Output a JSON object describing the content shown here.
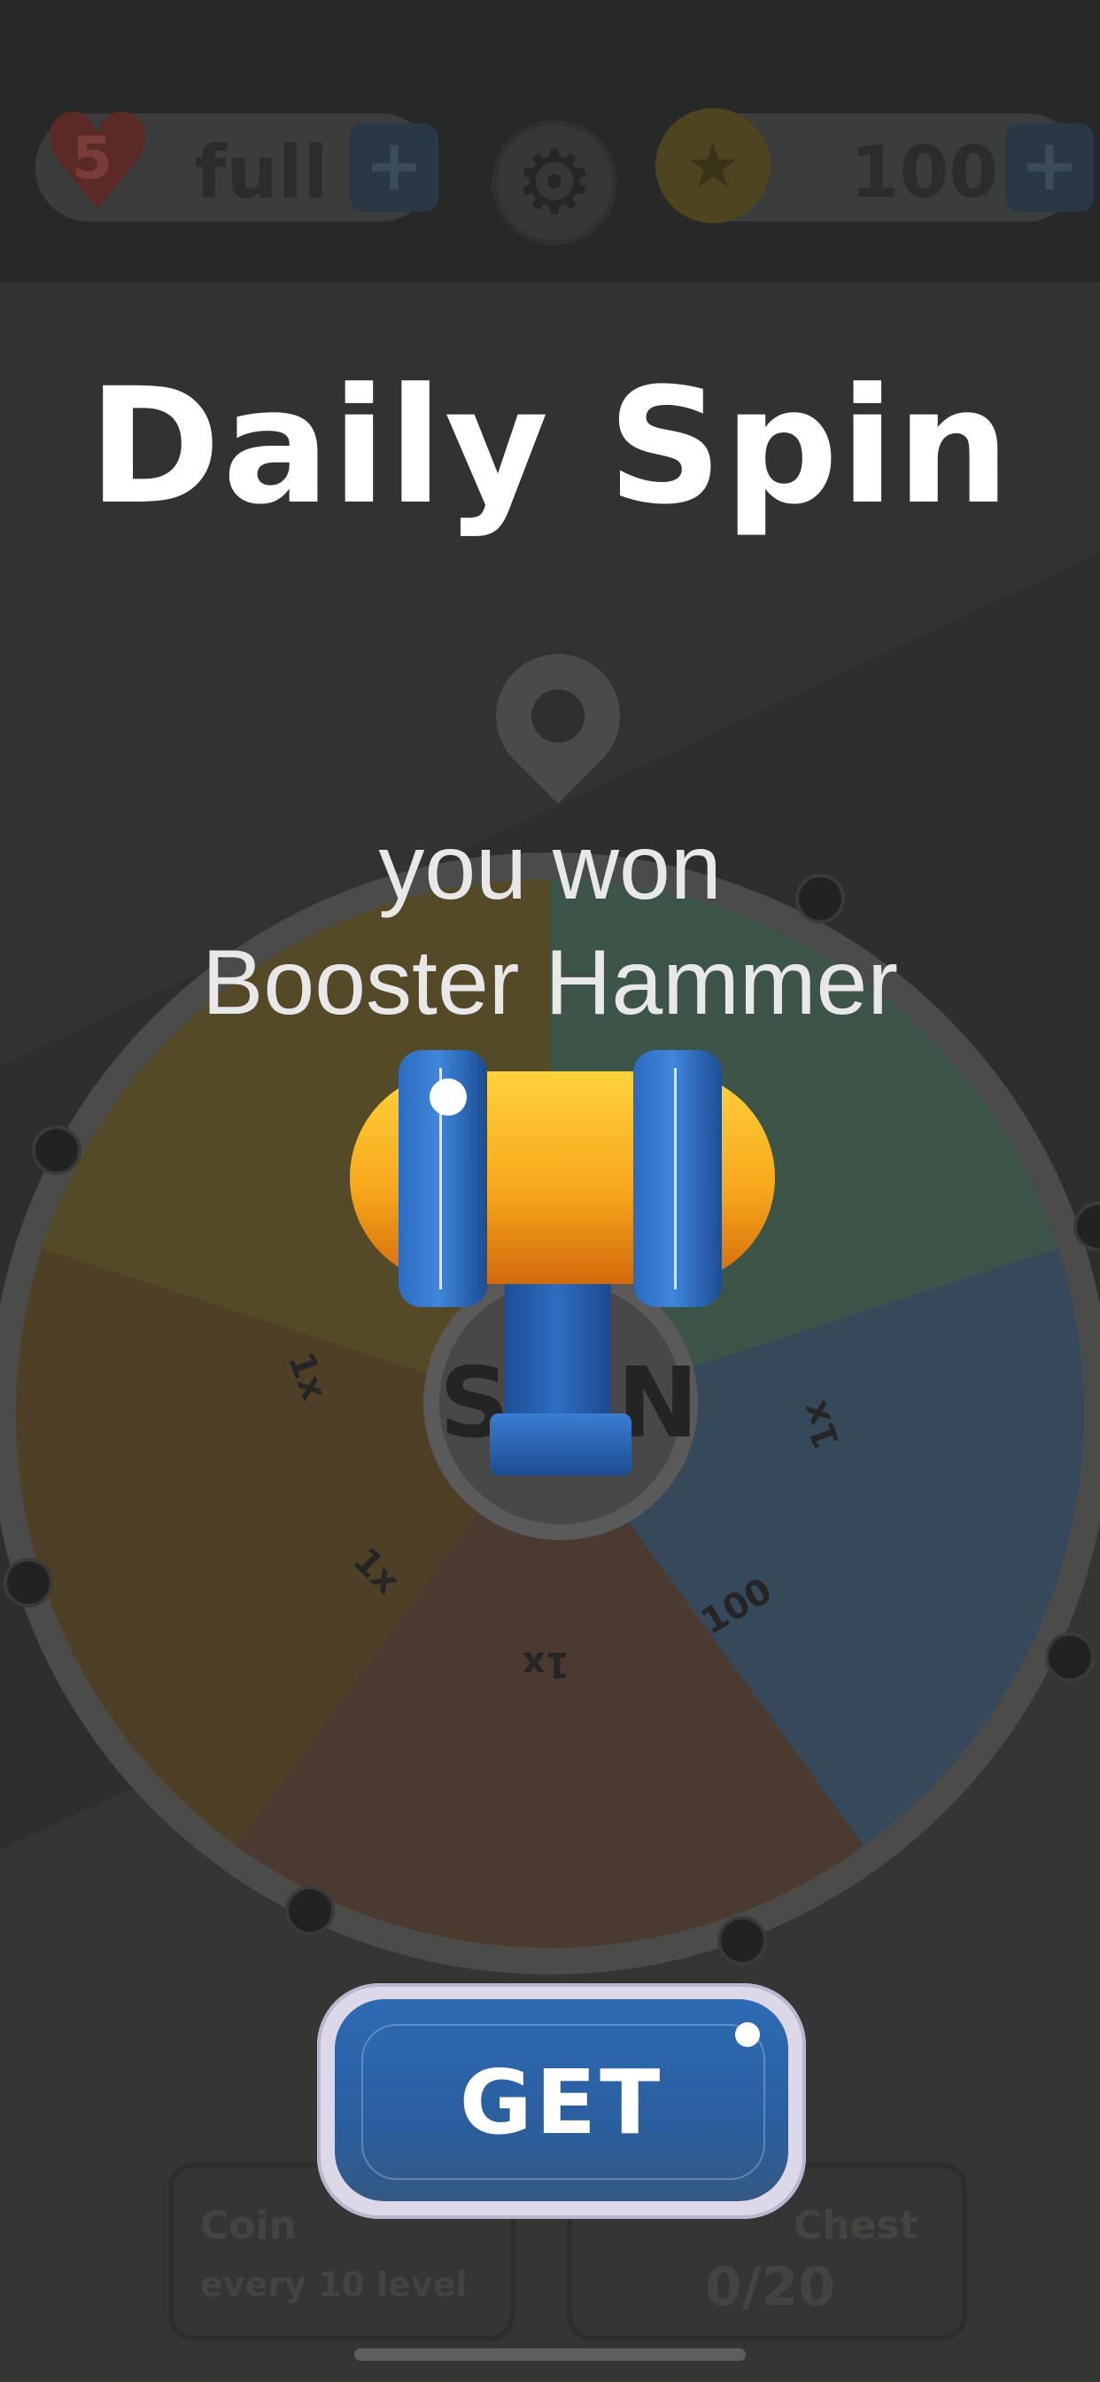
{
  "header": {
    "lives_count": "5",
    "lives_status": "full",
    "lives_add_label": "+",
    "coins": "100",
    "coins_add_label": "+"
  },
  "wheel": {
    "hub_label": "SPIN",
    "segments": [
      "1x",
      "1x",
      "100",
      "1x",
      "1x"
    ]
  },
  "dialog": {
    "title": "Daily Spin",
    "result_line1": "you won",
    "result_line2": "Booster Hammer",
    "prize_icon": "hammer-icon",
    "get_label": "GET"
  },
  "bottom": {
    "coin_card_title": "Coin",
    "coin_card_subtitle": "every 10 level",
    "chest_card_title": "Chest",
    "chest_progress": "0/20"
  },
  "colors": {
    "title": "#ffffff",
    "button_blue": "#2d6bb3",
    "button_rim": "#ddd8e8",
    "hammer_gold": "#f7a81b",
    "hammer_blue": "#2b6cc0"
  }
}
